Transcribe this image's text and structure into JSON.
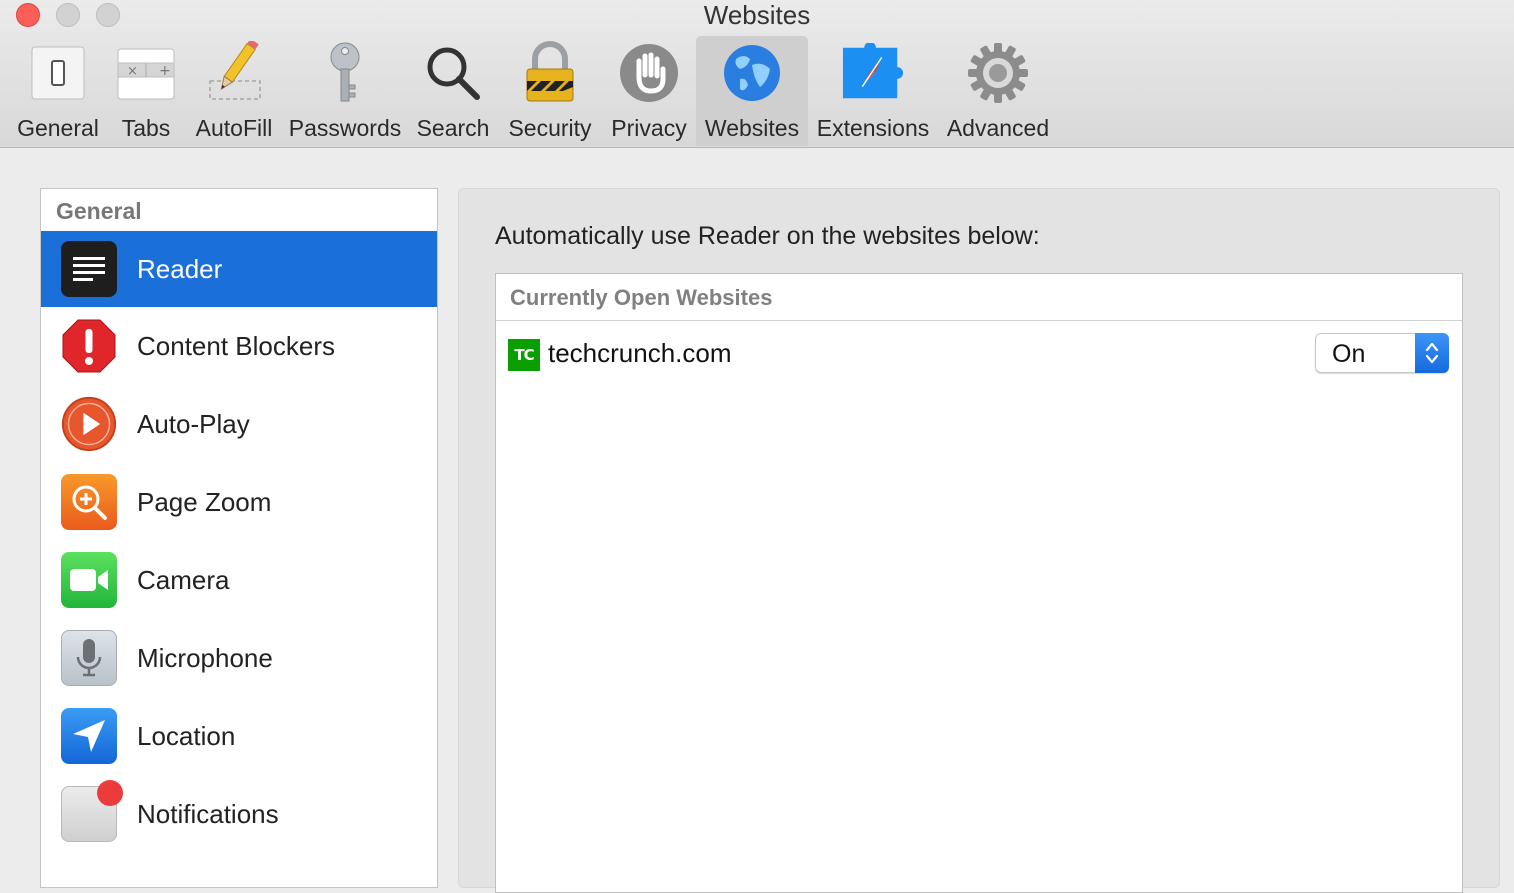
{
  "window": {
    "title": "Websites"
  },
  "toolbar": {
    "items": [
      {
        "label": "General",
        "icon": "general-switch-icon"
      },
      {
        "label": "Tabs",
        "icon": "tabs-icon"
      },
      {
        "label": "AutoFill",
        "icon": "pencil-icon"
      },
      {
        "label": "Passwords",
        "icon": "key-icon"
      },
      {
        "label": "Search",
        "icon": "magnifier-icon"
      },
      {
        "label": "Security",
        "icon": "padlock-icon"
      },
      {
        "label": "Privacy",
        "icon": "hand-icon"
      },
      {
        "label": "Websites",
        "icon": "globe-icon",
        "active": true
      },
      {
        "label": "Extensions",
        "icon": "puzzle-compass-icon"
      },
      {
        "label": "Advanced",
        "icon": "gear-icon"
      }
    ]
  },
  "sidebar": {
    "header": "General",
    "items": [
      {
        "label": "Reader",
        "icon": "reader-icon",
        "selected": true
      },
      {
        "label": "Content Blockers",
        "icon": "stop-sign-icon"
      },
      {
        "label": "Auto-Play",
        "icon": "play-icon"
      },
      {
        "label": "Page Zoom",
        "icon": "zoom-icon"
      },
      {
        "label": "Camera",
        "icon": "camera-icon"
      },
      {
        "label": "Microphone",
        "icon": "microphone-icon"
      },
      {
        "label": "Location",
        "icon": "location-arrow-icon"
      },
      {
        "label": "Notifications",
        "icon": "notification-badge-icon"
      }
    ]
  },
  "panel": {
    "heading": "Automatically use Reader on the websites below:",
    "table_header": "Currently Open Websites",
    "rows": [
      {
        "site": "techcrunch.com",
        "favicon_text": "TC",
        "setting": "On"
      }
    ]
  },
  "colors": {
    "selection": "#1a6fd8",
    "close_button": "#fc5f57",
    "favicon": "#0a9e01"
  }
}
